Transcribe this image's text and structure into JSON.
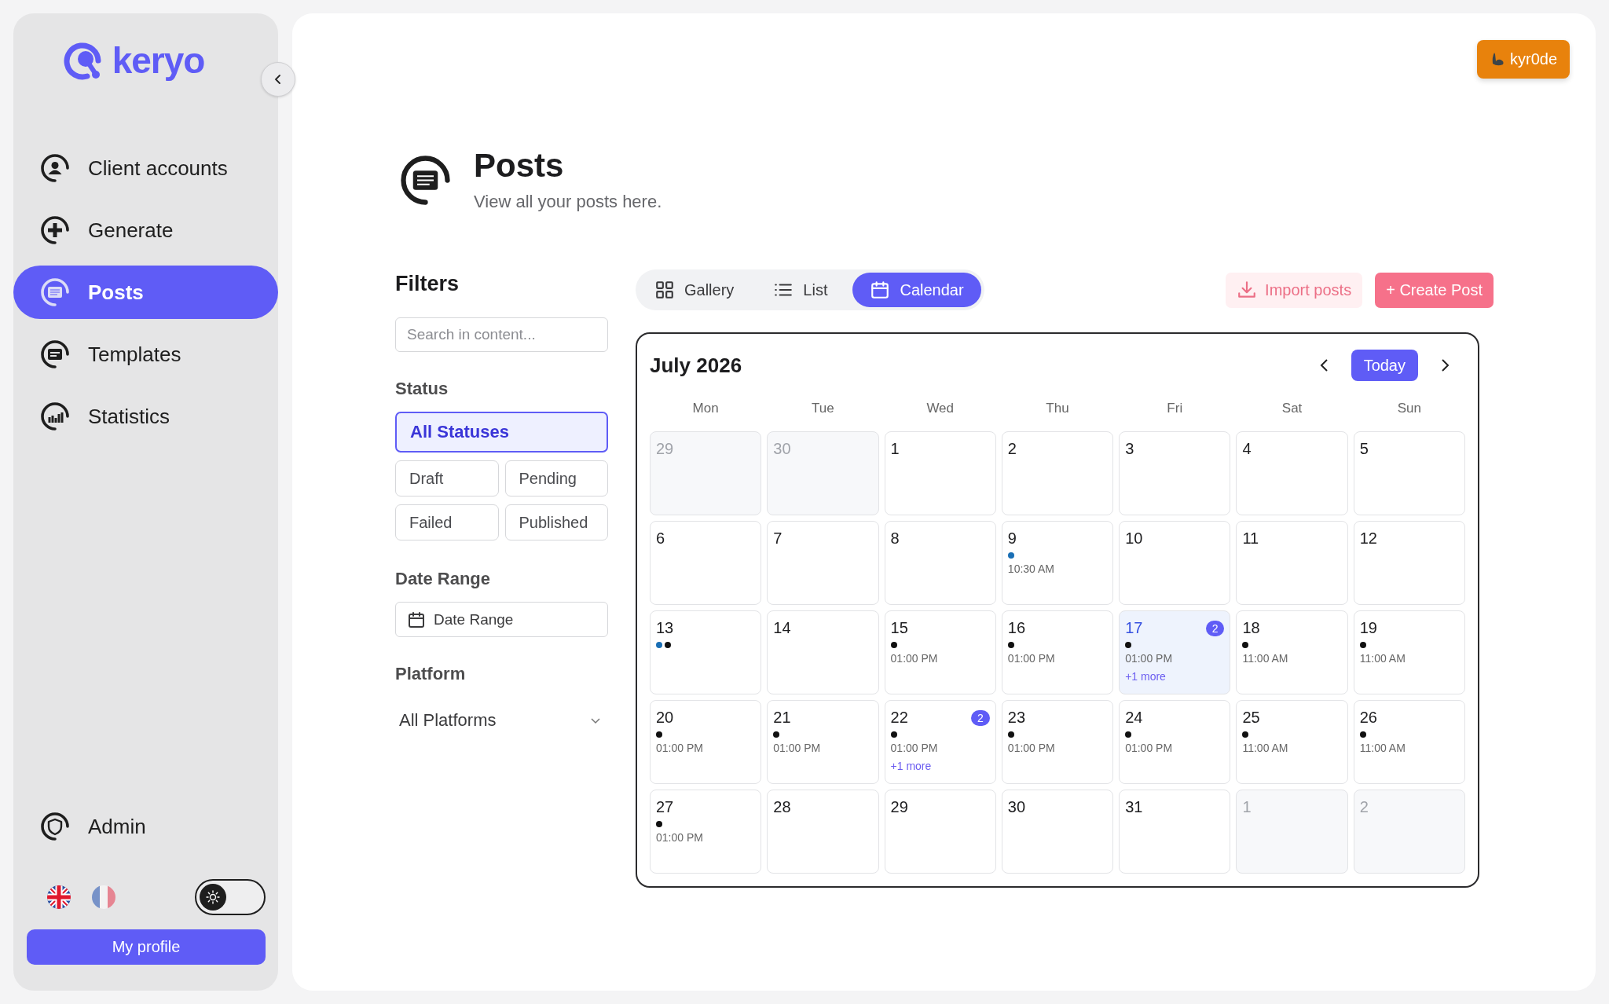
{
  "sidebar": {
    "logo": "keryo",
    "nav": [
      {
        "label": "Client accounts",
        "kind": "user",
        "selected": false
      },
      {
        "label": "Generate",
        "kind": "plus",
        "selected": false
      },
      {
        "label": "Posts",
        "kind": "posts",
        "selected": true
      },
      {
        "label": "Templates",
        "kind": "template",
        "selected": false
      },
      {
        "label": "Statistics",
        "kind": "chart",
        "selected": false
      }
    ],
    "footer_nav": [
      {
        "label": "Admin",
        "kind": "shield",
        "selected": false
      }
    ],
    "languages": [
      {
        "kind": "uk",
        "selected": true
      },
      {
        "kind": "fr",
        "selected": false
      }
    ],
    "theme_toggle": {
      "on": false
    },
    "profile_button": "My profile"
  },
  "user_button": "kyr0de",
  "header": {
    "title": "Posts",
    "subtitle": "View all your posts here."
  },
  "filters": {
    "title": "Filters",
    "search": {
      "placeholder": "Search in content..."
    },
    "status": {
      "label": "Status",
      "options": [
        {
          "label": "All Statuses",
          "selected": true
        },
        {
          "label": "Draft",
          "selected": false
        },
        {
          "label": "Pending",
          "selected": false
        },
        {
          "label": "Failed",
          "selected": false
        },
        {
          "label": "Published",
          "selected": false
        }
      ]
    },
    "date_range": {
      "label": "Date Range",
      "placeholder": "Date Range"
    },
    "platform": {
      "label": "Platform",
      "value": "All Platforms"
    }
  },
  "views": [
    {
      "label": "Gallery",
      "kind": "grid",
      "selected": false
    },
    {
      "label": "List",
      "kind": "list",
      "selected": false
    },
    {
      "label": "Calendar",
      "kind": "calendar",
      "selected": true
    }
  ],
  "actions": [
    {
      "label": "Import posts",
      "kind": "secondary"
    },
    {
      "label": "+ Create Post",
      "kind": "primary"
    }
  ],
  "calendar": {
    "title": "July 2026",
    "today_button": "Today",
    "weekdays": [
      "Mon",
      "Tue",
      "Wed",
      "Thu",
      "Fri",
      "Sat",
      "Sun"
    ],
    "days": [
      {
        "date": "29",
        "muted": true,
        "today": false
      },
      {
        "date": "30",
        "muted": true,
        "today": false
      },
      {
        "date": "1",
        "muted": false,
        "today": false
      },
      {
        "date": "2",
        "muted": false,
        "today": false
      },
      {
        "date": "3",
        "muted": false,
        "today": false
      },
      {
        "date": "4",
        "muted": false,
        "today": false
      },
      {
        "date": "5",
        "muted": false,
        "today": false
      },
      {
        "date": "6",
        "muted": false,
        "today": false
      },
      {
        "date": "7",
        "muted": false,
        "today": false
      },
      {
        "date": "8",
        "muted": false,
        "today": false
      },
      {
        "date": "9",
        "muted": false,
        "today": false,
        "dots": [
          {
            "color": "#1a6fb5"
          }
        ],
        "time": "10:30 AM"
      },
      {
        "date": "10",
        "muted": false,
        "today": false
      },
      {
        "date": "11",
        "muted": false,
        "today": false
      },
      {
        "date": "12",
        "muted": false,
        "today": false
      },
      {
        "date": "13",
        "muted": false,
        "today": false,
        "dots": [
          {
            "color": "#1a6fb5"
          },
          {
            "color": "#111111"
          }
        ]
      },
      {
        "date": "14",
        "muted": false,
        "today": false
      },
      {
        "date": "15",
        "muted": false,
        "today": false,
        "dots": [
          {
            "color": "#111111"
          }
        ],
        "time": "01:00 PM"
      },
      {
        "date": "16",
        "muted": false,
        "today": false,
        "dots": [
          {
            "color": "#111111"
          }
        ],
        "time": "01:00 PM"
      },
      {
        "date": "17",
        "muted": false,
        "today": true,
        "badge": "2",
        "dots": [
          {
            "color": "#111111"
          }
        ],
        "time": "01:00 PM",
        "more": "+1 more"
      },
      {
        "date": "18",
        "muted": false,
        "today": false,
        "dots": [
          {
            "color": "#111111"
          }
        ],
        "time": "11:00 AM"
      },
      {
        "date": "19",
        "muted": false,
        "today": false,
        "dots": [
          {
            "color": "#111111"
          }
        ],
        "time": "11:00 AM"
      },
      {
        "date": "20",
        "muted": false,
        "today": false,
        "dots": [
          {
            "color": "#111111"
          }
        ],
        "time": "01:00 PM"
      },
      {
        "date": "21",
        "muted": false,
        "today": false,
        "dots": [
          {
            "color": "#111111"
          }
        ],
        "time": "01:00 PM"
      },
      {
        "date": "22",
        "muted": false,
        "today": false,
        "badge": "2",
        "dots": [
          {
            "color": "#111111"
          }
        ],
        "time": "01:00 PM",
        "more": "+1 more"
      },
      {
        "date": "23",
        "muted": false,
        "today": false,
        "dots": [
          {
            "color": "#111111"
          }
        ],
        "time": "01:00 PM"
      },
      {
        "date": "24",
        "muted": false,
        "today": false,
        "dots": [
          {
            "color": "#111111"
          }
        ],
        "time": "01:00 PM"
      },
      {
        "date": "25",
        "muted": false,
        "today": false,
        "dots": [
          {
            "color": "#111111"
          }
        ],
        "time": "11:00 AM"
      },
      {
        "date": "26",
        "muted": false,
        "today": false,
        "dots": [
          {
            "color": "#111111"
          }
        ],
        "time": "11:00 AM"
      },
      {
        "date": "27",
        "muted": false,
        "today": false,
        "dots": [
          {
            "color": "#111111"
          }
        ],
        "time": "01:00 PM"
      },
      {
        "date": "28",
        "muted": false,
        "today": false
      },
      {
        "date": "29",
        "muted": false,
        "today": false
      },
      {
        "date": "30",
        "muted": false,
        "today": false
      },
      {
        "date": "31",
        "muted": false,
        "today": false
      },
      {
        "date": "1",
        "muted": true,
        "today": false
      },
      {
        "date": "2",
        "muted": true,
        "today": false
      }
    ]
  }
}
